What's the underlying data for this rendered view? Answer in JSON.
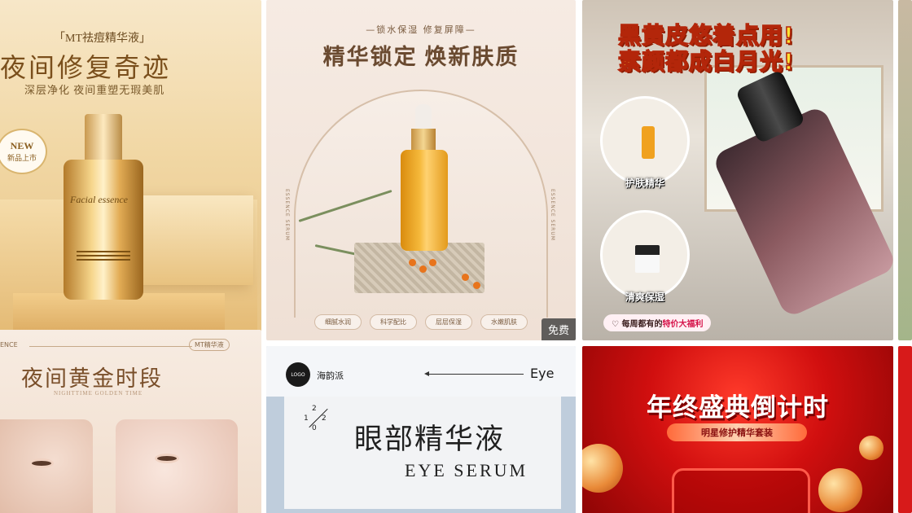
{
  "cards": [
    {
      "brand_tag": "「MT祛痘精华液」",
      "title": "夜间修复奇迹",
      "subtitle": "深层净化 夜间重塑无瑕美肌",
      "badge_new": "NEW",
      "badge_sub": "新品上市",
      "bottle_label": "Facial essence"
    },
    {
      "top_tag": "—锁水保湿 修复屏障—",
      "title": "精华锁定 焕新肤质",
      "side_text_left": "ESSENCE SERUM",
      "side_text_right": "ESSENCE SERUM",
      "chips": [
        "细腻水润",
        "科学配比",
        "层层保湿",
        "水嫩肌肤"
      ],
      "free_badge": "免费"
    },
    {
      "line1": "黑黄皮悠着点用!",
      "line2": "素颜都成白月光!",
      "bubble1": "护肤精华",
      "bubble2": "清爽保湿",
      "promo_prefix": "每周都有的",
      "promo_highlight": "特价大福利"
    },
    {
      "header_left": "ENCE",
      "header_tag": "MT精华液",
      "title": "夜间黄金时段",
      "subtitle": "NIGHTTIME GOLDEN TIME"
    },
    {
      "logo": "LOGO",
      "brand": "海韵派",
      "eye_label": "Eye",
      "number_1": "1",
      "number_2a": "2",
      "number_2b": "2",
      "number_0": "0",
      "title_cn": "眼部精华液",
      "title_en": "EYE SERUM"
    },
    {
      "title": "年终盛典倒计时",
      "pill": "明星修护精华套装"
    }
  ],
  "colors": {
    "gold": "#e7c282",
    "headline_yellow": "#ffe233",
    "sale_red": "#d10f0f"
  }
}
